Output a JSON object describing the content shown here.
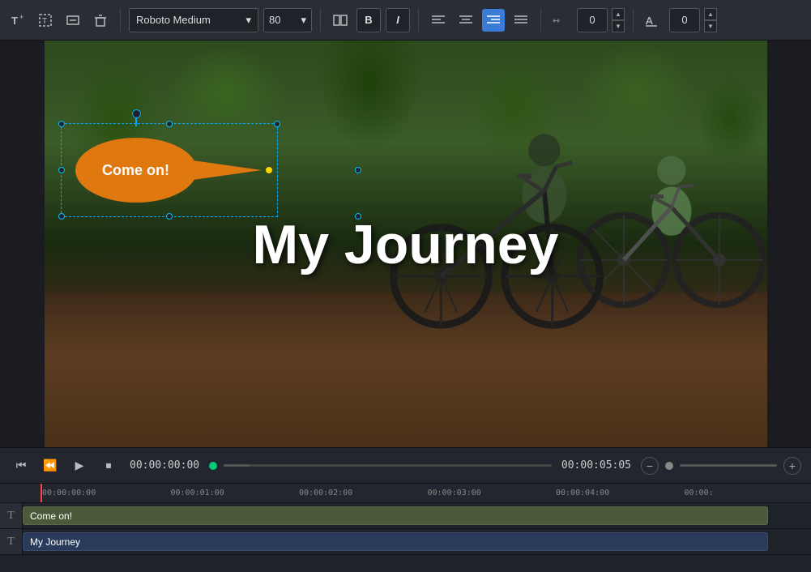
{
  "toolbar": {
    "add_text_label": "T+",
    "font_name": "Roboto Medium",
    "font_size": "80",
    "bold_label": "B",
    "italic_label": "I",
    "align_left_label": "≡",
    "align_center_label": "≡",
    "align_right_label": "≡",
    "justify_label": "≡",
    "spacing_label": "⇿",
    "spacing_value": "0",
    "outline_label": "A͟",
    "outline_value": "0"
  },
  "canvas": {
    "callout_text": "Come on!",
    "journey_text": "My Journey"
  },
  "playback": {
    "current_time": "00:00:00:00",
    "total_time": "00:00:05:05"
  },
  "timeline": {
    "ruler_marks": [
      "00:00:00:00",
      "00:00:01:00",
      "00:00:02:00",
      "00:00:03:00",
      "00:00:04:00",
      "00:00:"
    ],
    "tracks": [
      {
        "id": "come-on-track",
        "icon": "T",
        "clip_label": "Come on!"
      },
      {
        "id": "my-journey-track",
        "icon": "T",
        "clip_label": "My Journey"
      }
    ]
  }
}
